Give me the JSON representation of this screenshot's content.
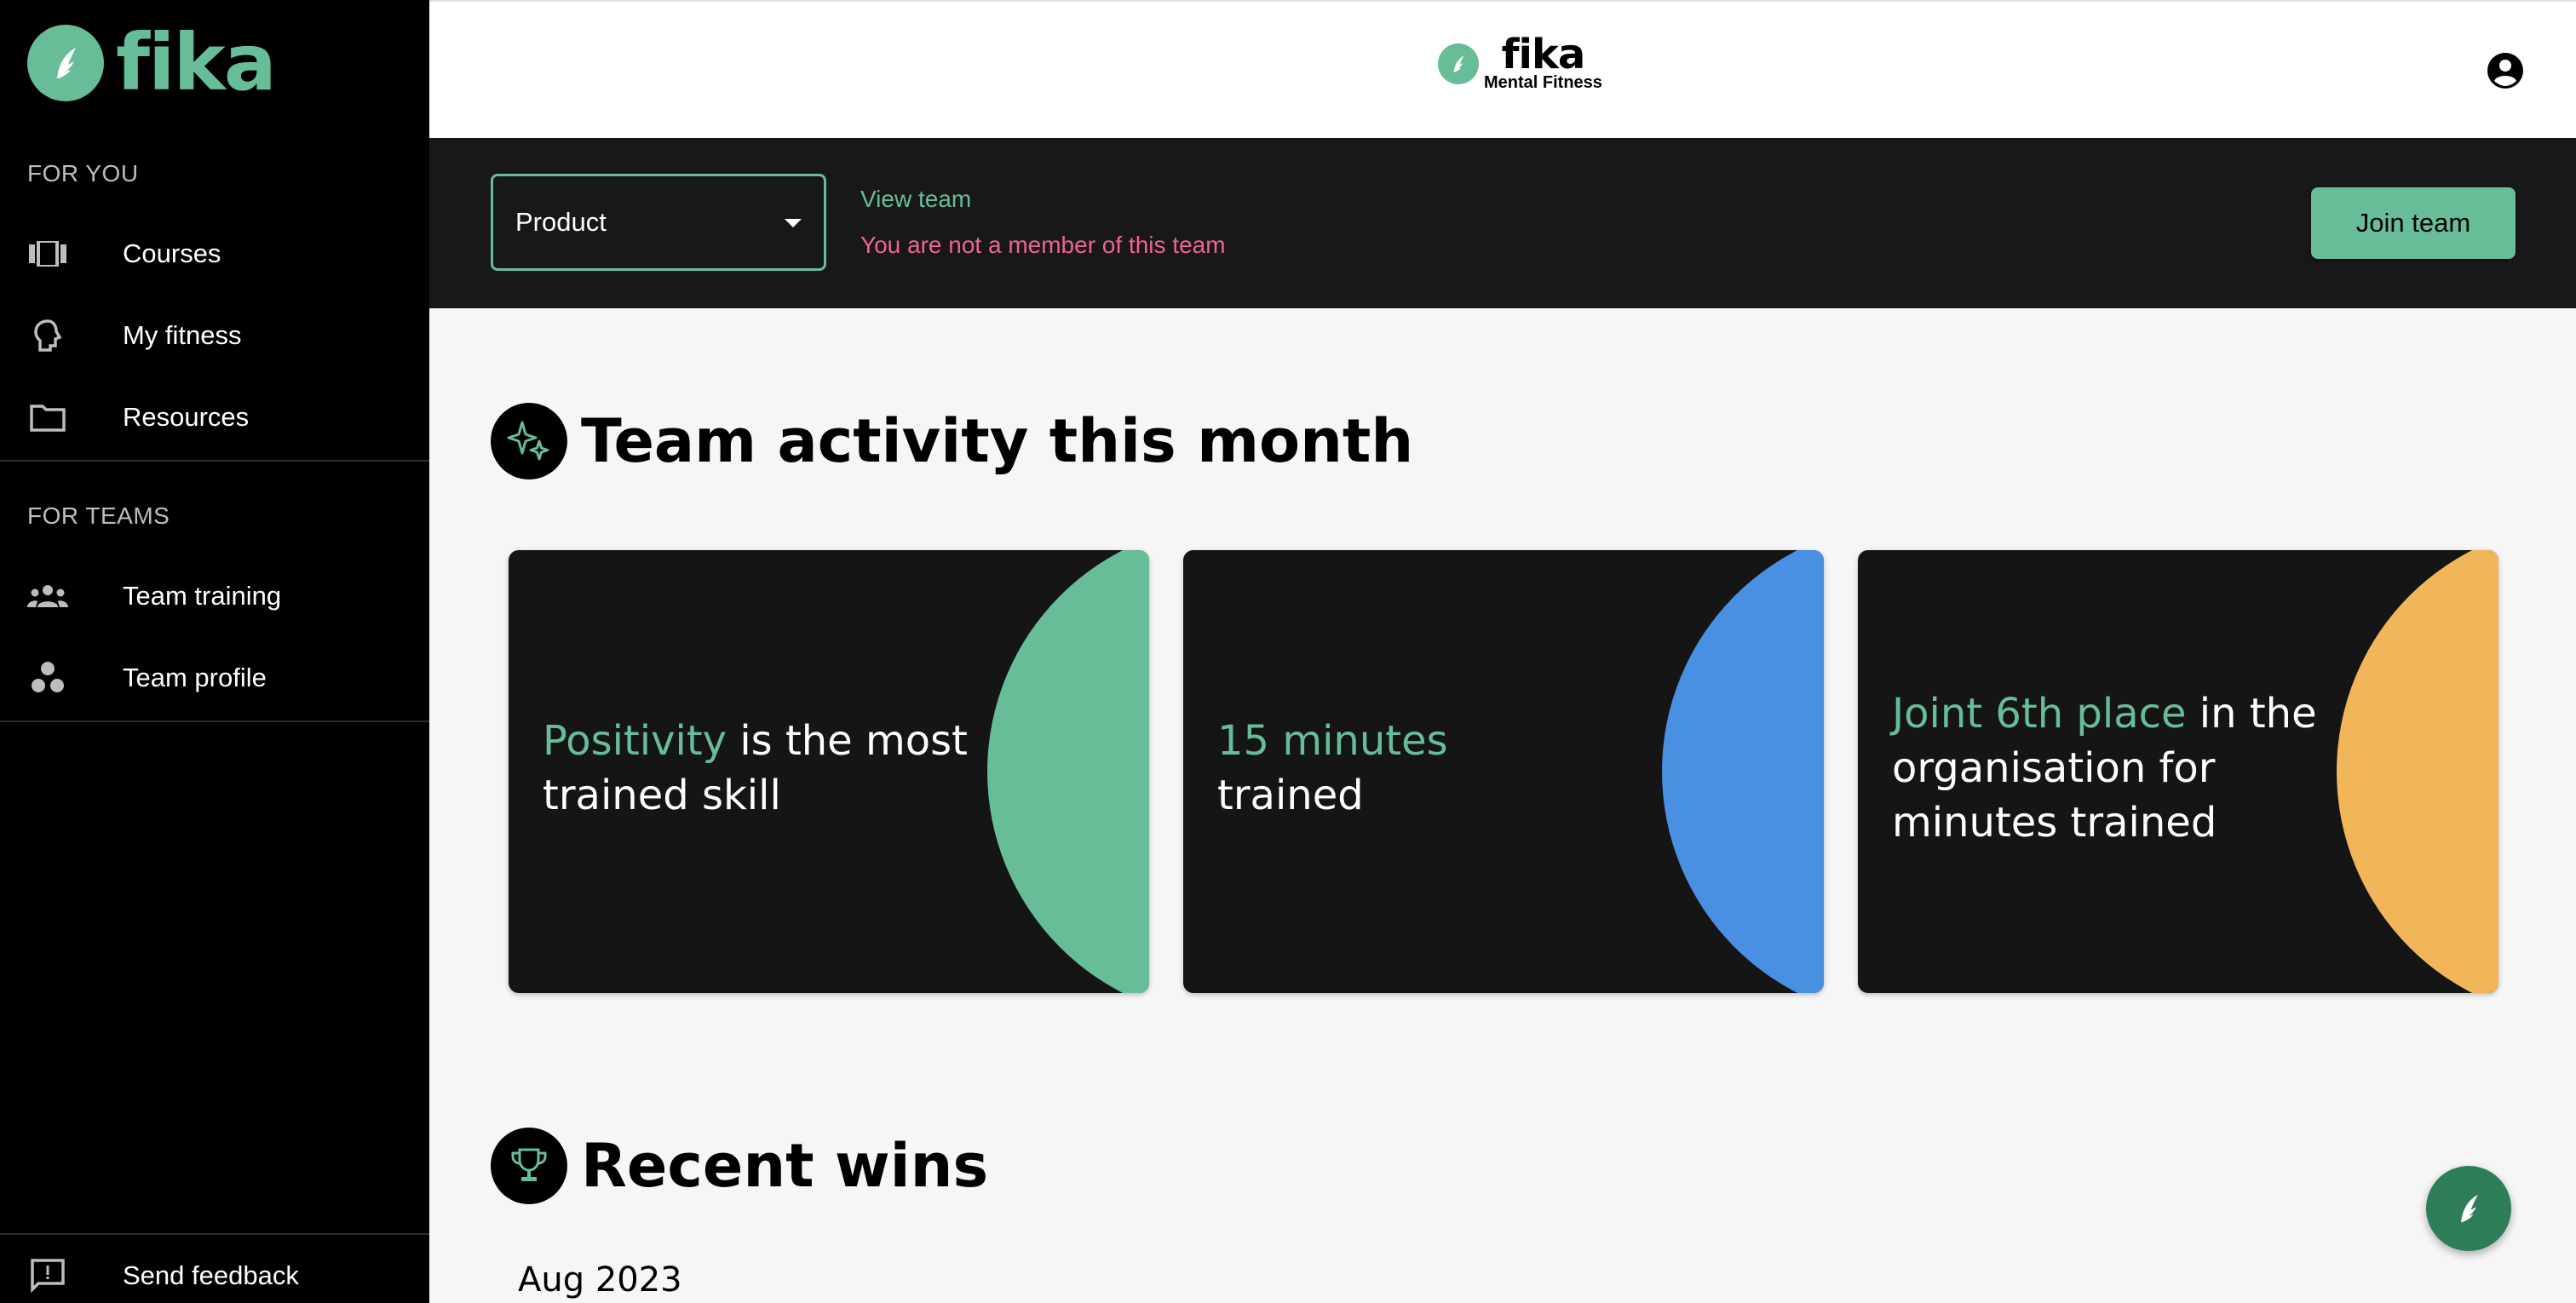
{
  "brand": {
    "name": "fika",
    "color": "#67bd97"
  },
  "header": {
    "logo_word": "fika",
    "logo_sub": "Mental Fitness"
  },
  "sidebar": {
    "for_you_label": "FOR YOU",
    "for_you_items": [
      {
        "label": "Courses",
        "icon": "courses-icon"
      },
      {
        "label": "My fitness",
        "icon": "head-icon"
      },
      {
        "label": "Resources",
        "icon": "folder-icon"
      }
    ],
    "for_teams_label": "FOR TEAMS",
    "for_teams_items": [
      {
        "label": "Team training",
        "icon": "team-icon"
      },
      {
        "label": "Team profile",
        "icon": "team-profile-icon"
      }
    ],
    "feedback_label": "Send feedback"
  },
  "teambar": {
    "selected_team": "Product",
    "view_team": "View team",
    "not_member": "You are not a member of this team",
    "join_button": "Join team"
  },
  "activity": {
    "title": "Team activity this month",
    "cards": [
      {
        "highlight": "Positivity",
        "rest": " is the most trained skill",
        "accent": "#67bd97"
      },
      {
        "highlight": "15 minutes",
        "rest": "trained",
        "accent": "#4a90e2"
      },
      {
        "highlight": "Joint 6th place",
        "rest": " in the organisation for minutes trained",
        "accent": "#f2b65a"
      }
    ]
  },
  "wins": {
    "title": "Recent wins",
    "month": "Aug 2023"
  }
}
